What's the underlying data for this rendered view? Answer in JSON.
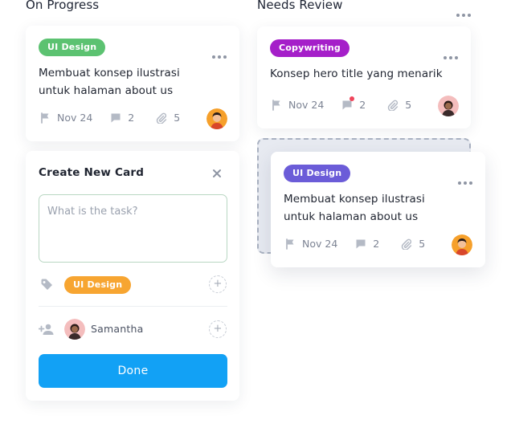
{
  "columns": {
    "on_progress": {
      "title": "On Progress"
    },
    "needs_review": {
      "title": "Needs Review"
    }
  },
  "cards": {
    "card1": {
      "tag": "UI Design",
      "tag_color": "#5cc271",
      "description_line1": "Membuat konsep ilustrasi",
      "description_line2": "untuk halaman about us",
      "date": "Nov 24",
      "comments": "2",
      "attachments": "5"
    },
    "card2": {
      "tag": "Copywriting",
      "tag_color": "#a51fc9",
      "description_line1": "Konsep hero title yang menarik",
      "date": "Nov 24",
      "comments": "2",
      "attachments": "5",
      "notification_color": "#f0455b"
    },
    "card3": {
      "tag": "UI Design",
      "tag_color": "#6b5cd8",
      "description_line1": "Membuat konsep ilustrasi",
      "description_line2": "untuk halaman about us",
      "date": "Nov 24",
      "comments": "2",
      "attachments": "5"
    }
  },
  "create_card": {
    "title": "Create New Card",
    "task_placeholder": "What is the task?",
    "task_value": "",
    "label_tag": "UI Design",
    "label_tag_color": "#f7a531",
    "assignee": "Samantha",
    "done_label": "Done",
    "done_color": "#12a1f5"
  },
  "icons": [
    "more-dots-icon",
    "flag-icon",
    "comment-icon",
    "paperclip-icon",
    "close-icon",
    "tag-icon",
    "add-user-icon",
    "plus-icon"
  ]
}
